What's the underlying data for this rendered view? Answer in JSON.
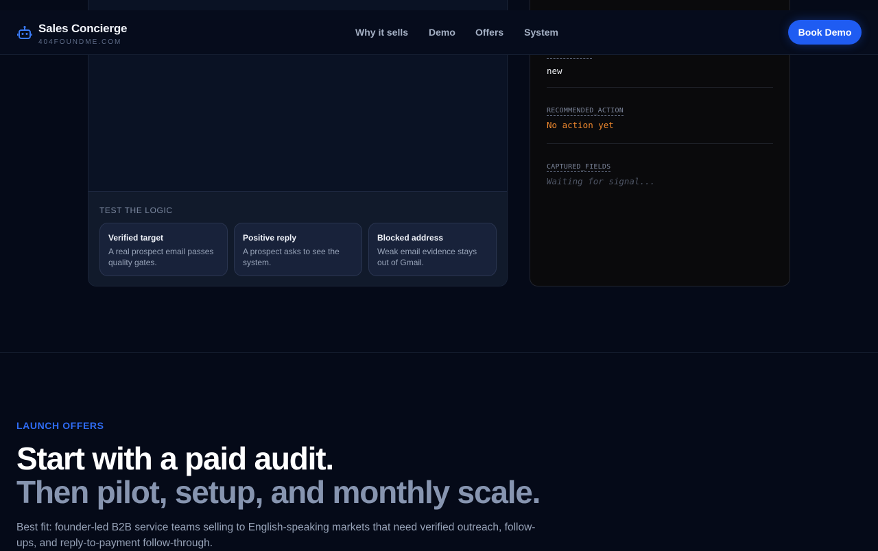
{
  "header": {
    "brand_name": "Sales Concierge",
    "brand_domain": "404FOUNDME.COM",
    "brand_icon": "robot-icon",
    "nav": [
      {
        "label": "Why it sells"
      },
      {
        "label": "Demo"
      },
      {
        "label": "Offers"
      },
      {
        "label": "System"
      }
    ],
    "cta_label": "Book Demo"
  },
  "demo": {
    "logic_label": "TEST THE LOGIC",
    "scenarios": [
      {
        "title": "Verified target",
        "description": "A real prospect email passes quality gates."
      },
      {
        "title": "Positive reply",
        "description": "A prospect asks to see the system."
      },
      {
        "title": "Blocked address",
        "description": "Weak email evidence stays out of Gmail."
      }
    ]
  },
  "output": {
    "fields": [
      {
        "key": "",
        "value": "new"
      },
      {
        "key": "RECOMMENDED_ACTION",
        "value": "No action yet"
      },
      {
        "key": "CAPTURED_FIELDS",
        "value": "Waiting for signal..."
      }
    ]
  },
  "offers": {
    "eyebrow": "LAUNCH OFFERS",
    "headline_line1": "Start with a paid audit.",
    "headline_line2": "Then pilot, setup, and monthly scale.",
    "lede": "Best fit: founder-led B2B service teams selling to English-speaking markets that need verified outreach, follow-ups, and reply-to-payment follow-through."
  },
  "colors": {
    "accent": "#1f5cf2",
    "action_orange": "#f28a2e",
    "background": "#050a18"
  }
}
